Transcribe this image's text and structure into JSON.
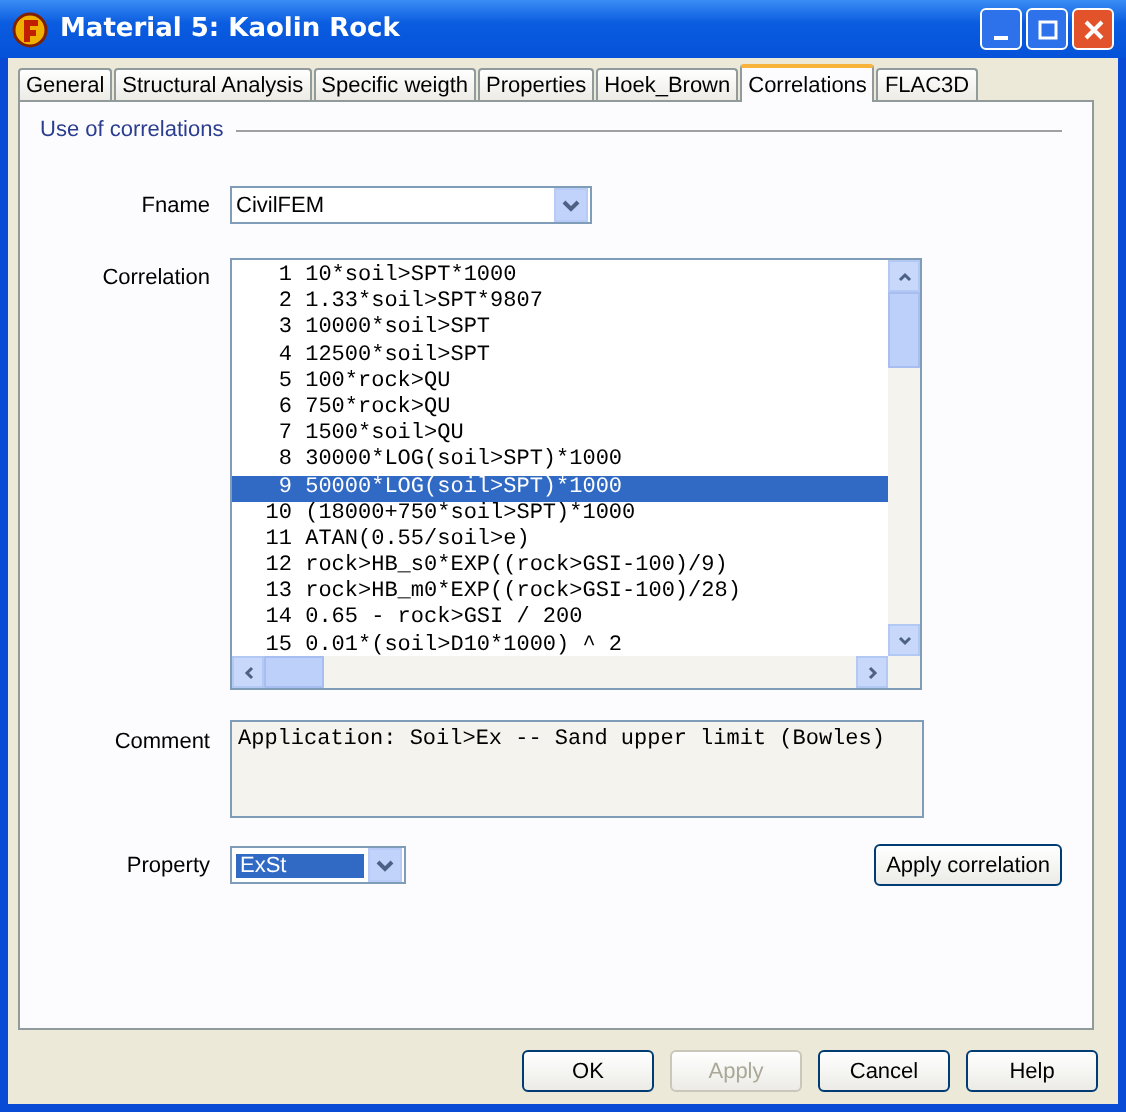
{
  "window": {
    "title": "Material 5: Kaolin Rock"
  },
  "tabs": [
    {
      "label": "General",
      "selected": false
    },
    {
      "label": "Structural Analysis",
      "selected": false
    },
    {
      "label": "Specific weigth",
      "selected": false
    },
    {
      "label": "Properties",
      "selected": false
    },
    {
      "label": "Hoek_Brown",
      "selected": false
    },
    {
      "label": "Correlations",
      "selected": true
    },
    {
      "label": "FLAC3D",
      "selected": false
    }
  ],
  "group": {
    "legend": "Use of correlations"
  },
  "fname": {
    "label": "Fname",
    "value": "CivilFEM"
  },
  "correlation": {
    "label": "Correlation",
    "items": [
      {
        "number": "1",
        "formula": "10*soil>SPT*1000",
        "selected": false
      },
      {
        "number": "2",
        "formula": "1.33*soil>SPT*9807",
        "selected": false
      },
      {
        "number": "3",
        "formula": "10000*soil>SPT",
        "selected": false
      },
      {
        "number": "4",
        "formula": "12500*soil>SPT",
        "selected": false
      },
      {
        "number": "5",
        "formula": "100*rock>QU",
        "selected": false
      },
      {
        "number": "6",
        "formula": "750*rock>QU",
        "selected": false
      },
      {
        "number": "7",
        "formula": "1500*soil>QU",
        "selected": false
      },
      {
        "number": "8",
        "formula": "30000*LOG(soil>SPT)*1000",
        "selected": false
      },
      {
        "number": "9",
        "formula": "50000*LOG(soil>SPT)*1000",
        "selected": true
      },
      {
        "number": "10",
        "formula": "(18000+750*soil>SPT)*1000",
        "selected": false
      },
      {
        "number": "11",
        "formula": "ATAN(0.55/soil>e)",
        "selected": false
      },
      {
        "number": "12",
        "formula": "rock>HB_s0*EXP((rock>GSI-100)/9)",
        "selected": false
      },
      {
        "number": "13",
        "formula": "rock>HB_m0*EXP((rock>GSI-100)/28)",
        "selected": false
      },
      {
        "number": "14",
        "formula": "0.65 - rock>GSI / 200",
        "selected": false
      },
      {
        "number": "15",
        "formula": "0.01*(soil>D10*1000) ^ 2",
        "selected": false
      }
    ]
  },
  "comment": {
    "label": "Comment",
    "value": "Application: Soil>Ex -- Sand upper limit (Bowles)"
  },
  "property": {
    "label": "Property",
    "value": "ExSt"
  },
  "apply_correlation": {
    "label": "Apply correlation"
  },
  "buttons": [
    {
      "label": "OK",
      "disabled": false
    },
    {
      "label": "Apply",
      "disabled": true
    },
    {
      "label": "Cancel",
      "disabled": false
    },
    {
      "label": "Help",
      "disabled": false
    }
  ]
}
